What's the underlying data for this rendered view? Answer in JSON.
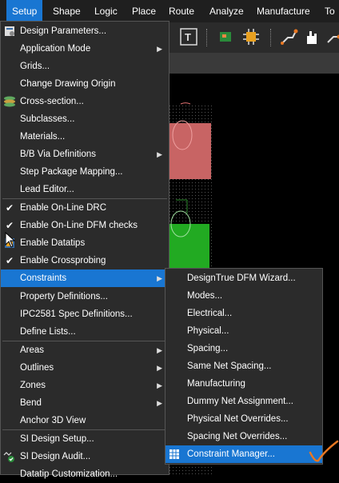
{
  "menubar": {
    "items": [
      "Setup",
      "Shape",
      "Logic",
      "Place",
      "Route",
      "Analyze",
      "Manufacture",
      "To"
    ],
    "active": "Setup"
  },
  "setup_menu": {
    "items": [
      {
        "label": "Design Parameters...",
        "icon": "design-parameters-icon"
      },
      {
        "label": "Application Mode",
        "submenu": true
      },
      {
        "label": "Grids..."
      },
      {
        "label": "Change Drawing Origin"
      },
      {
        "label": "Cross-section...",
        "icon": "cross-section-icon"
      },
      {
        "label": "Subclasses..."
      },
      {
        "label": "Materials..."
      },
      {
        "label": "B/B Via Definitions",
        "submenu": true
      },
      {
        "label": "Step Package Mapping..."
      },
      {
        "label": "Lead Editor..."
      },
      {
        "label": "Enable On-Line DRC",
        "checked": true
      },
      {
        "label": "Enable On-Line DFM checks",
        "checked": true
      },
      {
        "label": "Enable Datatips",
        "icon": "datatips-icon"
      },
      {
        "label": "Enable Crossprobing",
        "checked": true
      },
      {
        "label": "Constraints",
        "submenu": true,
        "highlighted": true
      },
      {
        "label": "Property Definitions..."
      },
      {
        "label": "IPC2581 Spec Definitions..."
      },
      {
        "label": "Define Lists..."
      },
      {
        "label": "Areas",
        "submenu": true
      },
      {
        "label": "Outlines",
        "submenu": true
      },
      {
        "label": "Zones",
        "submenu": true
      },
      {
        "label": "Bend",
        "submenu": true
      },
      {
        "label": "Anchor 3D View"
      },
      {
        "label": "SI Design Setup..."
      },
      {
        "label": "SI Design Audit...",
        "icon": "si-audit-icon"
      },
      {
        "label": "Datatip Customization..."
      }
    ]
  },
  "constraints_submenu": {
    "items": [
      {
        "label": "DesignTrue DFM Wizard..."
      },
      {
        "label": "Modes..."
      },
      {
        "label": "Electrical..."
      },
      {
        "label": "Physical..."
      },
      {
        "label": "Spacing..."
      },
      {
        "label": "Same Net Spacing..."
      },
      {
        "label": "Manufacturing"
      },
      {
        "label": "Dummy Net Assignment..."
      },
      {
        "label": "Physical Net Overrides..."
      },
      {
        "label": "Spacing Net Overrides..."
      },
      {
        "label": "Constraint Manager...",
        "highlighted": true,
        "icon": "constraint-manager-icon"
      }
    ]
  },
  "colors": {
    "highlight": "#1976d2",
    "menu_bg": "#2b2b2b",
    "pad_red": "#c86464",
    "pad_green": "#22aa22",
    "annotation": "#e87722"
  }
}
